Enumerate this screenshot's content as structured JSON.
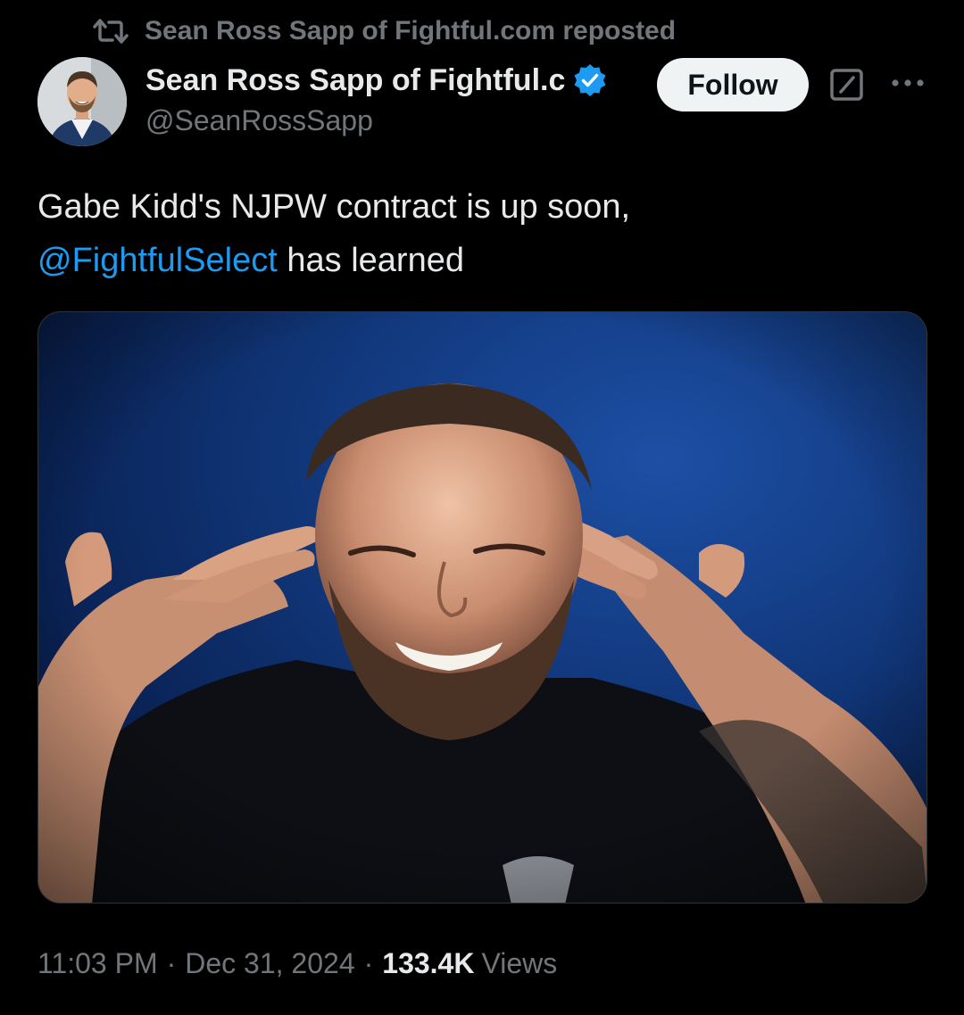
{
  "repost": {
    "icon": "repost-icon",
    "label": "Sean Ross Sapp of Fightful.com reposted"
  },
  "author": {
    "display_name": "Sean Ross Sapp of Fightful.c",
    "handle": "@SeanRossSapp",
    "verified": true,
    "avatar": "avatar-photo"
  },
  "actions": {
    "follow_label": "Follow",
    "grok_icon": "grok-icon",
    "more_icon": "more-icon"
  },
  "tweet": {
    "text_line1": "Gabe Kidd's NJPW contract is up soon,",
    "mention": "@FightfulSelect",
    "text_after_mention": "has learned"
  },
  "media": {
    "icon": "photo"
  },
  "meta": {
    "time": "11:03 PM",
    "separator": "·",
    "date": "Dec 31, 2024",
    "views_count": "133.4K",
    "views_label": "Views"
  },
  "colors": {
    "background": "#000000",
    "text_primary": "#e7e9ea",
    "text_secondary": "#71767b",
    "link": "#1d9bf0",
    "verified": "#1d9bf0",
    "follow_bg": "#eff3f4"
  }
}
